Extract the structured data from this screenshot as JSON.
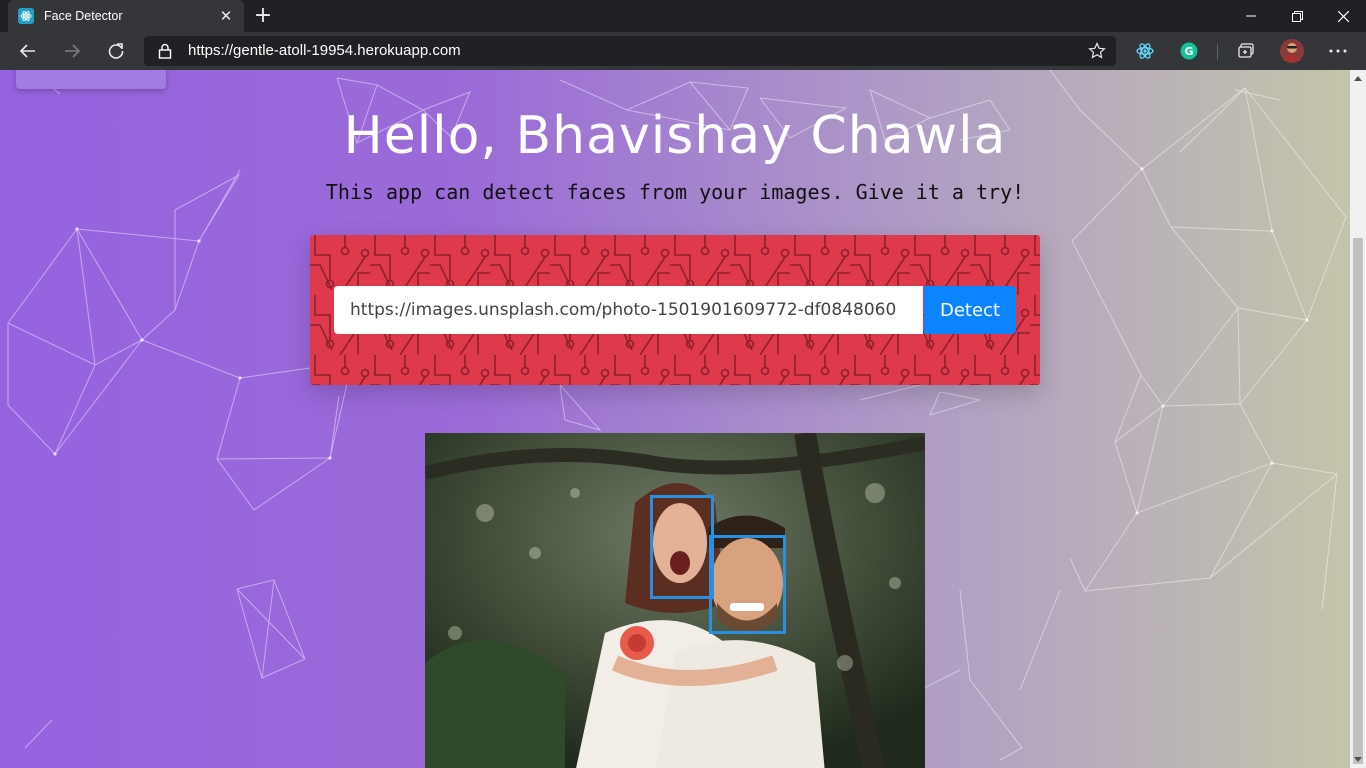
{
  "browser": {
    "tab_title": "Face Detector",
    "tab_close": "✕",
    "new_tab": "+",
    "url": "https://gentle-atoll-19954.herokuapp.com",
    "window_controls": {
      "minimize": "minimize-icon",
      "maximize": "restore-icon",
      "close": "close-icon"
    },
    "toolbar_icons": [
      "back-icon",
      "forward-icon",
      "refresh-icon",
      "lock-icon",
      "star-icon",
      "react-devtools-icon",
      "grammarly-icon",
      "collections-icon",
      "profile-avatar",
      "more-icon"
    ]
  },
  "page": {
    "heading": "Hello, Bhavishay Chawla",
    "subheading": "This app can detect faces from your images. Give it a try!",
    "form": {
      "input_value": "https://images.unsplash.com/photo-1501901609772-df0848060",
      "button_label": "Detect"
    },
    "detected_faces": 2,
    "colors": {
      "gradient_start": "#9563e0",
      "gradient_end": "#c4c5aa",
      "panel_red": "#df3a4b",
      "button_blue": "#0d84ff",
      "face_box": "#2a8fe0"
    }
  }
}
